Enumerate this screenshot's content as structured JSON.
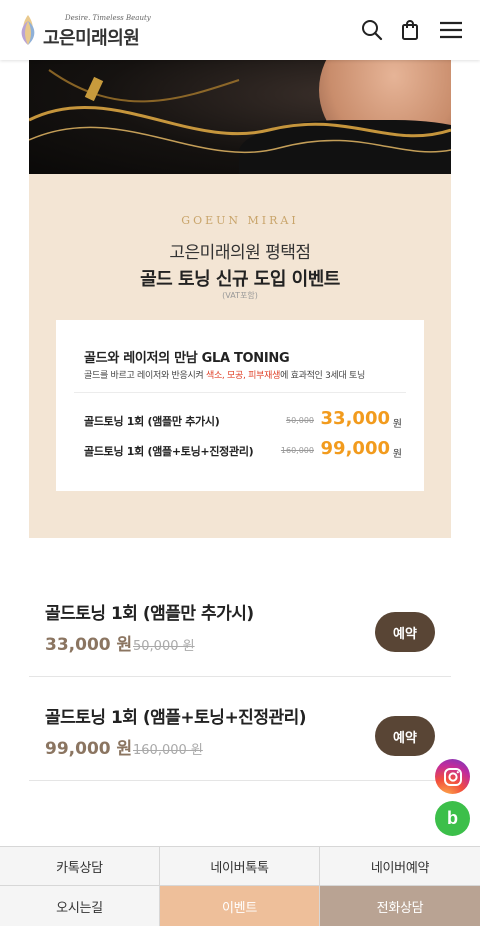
{
  "header": {
    "logo_tagline": "Desire. Timeless Beauty",
    "logo_name": "고은미래의원",
    "icons": [
      "search-icon",
      "shopping-bag-icon",
      "hamburger-menu-icon"
    ]
  },
  "event": {
    "brand_en": "GOEUN MIRAI",
    "branch": "고은미래의원 평택점",
    "title": "골드 토닝 신규 도입 이벤트",
    "vat": "(VAT포함)",
    "card": {
      "heading": "골드와 레이저의 만남 GLA TONING",
      "desc_before": "골드를 바르고 레이저와 반응시켜 ",
      "desc_highlight": "색소, 모공, 피부재생",
      "desc_after": "에 효과적인 3세대 토닝",
      "rows": [
        {
          "name": "골드토닝 1회 (앰플만 추가시)",
          "old_price": "50,000",
          "price": "33,000",
          "unit": "원"
        },
        {
          "name": "골드토닝 1회 (앰플+토닝+진정관리)",
          "old_price": "160,000",
          "price": "99,000",
          "unit": "원"
        }
      ]
    },
    "colors": {
      "panel": "#f3e5d4",
      "price_accent": "#f29b1d",
      "highlight": "#e0432b"
    }
  },
  "products": [
    {
      "name": "골드토닝 1회 (앰플만 추가시)",
      "price": "33,000 원",
      "old_price": "50,000 원",
      "button": "예약"
    },
    {
      "name": "골드토닝 1회 (앰플+토닝+진정관리)",
      "price": "99,000 원",
      "old_price": "160,000 원",
      "button": "예약"
    }
  ],
  "floating": {
    "instagram_icon": "instagram-icon",
    "blog_label": "b"
  },
  "bottom_nav": {
    "row1": [
      "카톡상담",
      "네이버톡톡",
      "네이버예약"
    ],
    "row2": [
      "오시는길",
      "이벤트",
      "전화상담"
    ]
  }
}
